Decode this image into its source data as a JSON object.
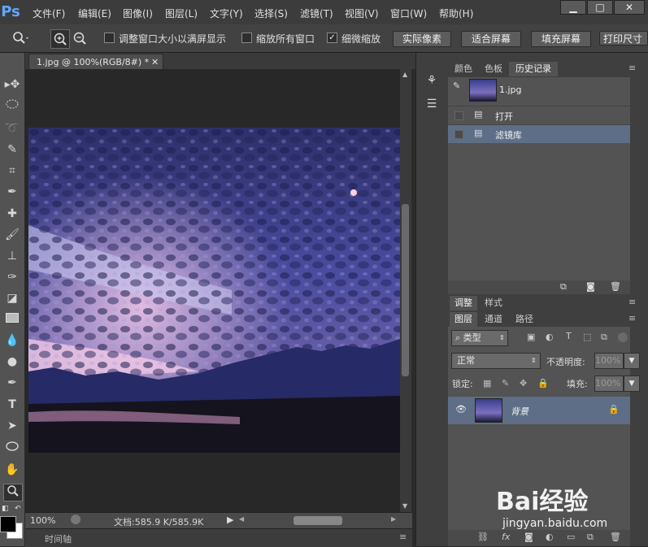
{
  "app": {
    "logo": "Ps"
  },
  "menu": [
    "文件(F)",
    "编辑(E)",
    "图像(I)",
    "图层(L)",
    "文字(Y)",
    "选择(S)",
    "滤镜(T)",
    "视图(V)",
    "窗口(W)",
    "帮助(H)"
  ],
  "window_controls": {
    "minimize": "▁",
    "maximize": "□",
    "close": "✕"
  },
  "options": {
    "resize_windows": {
      "label": "调整窗口大小以满屏显示",
      "checked": false
    },
    "zoom_all": {
      "label": "缩放所有窗口",
      "checked": false
    },
    "scrubby_zoom": {
      "label": "细微缩放",
      "checked": true
    },
    "actual_pixels": "实际像素",
    "fit_screen": "适合屏幕",
    "fill_screen": "填充屏幕",
    "print_size": "打印尺寸"
  },
  "document": {
    "tab_title": "1.jpg @ 100%(RGB/8#) *",
    "zoom": "100%",
    "doc_info": "文档:585.9 K/585.9K"
  },
  "timeline": {
    "label": "时间轴"
  },
  "panels": {
    "top_tabs": [
      "颜色",
      "色板",
      "历史记录"
    ],
    "history": {
      "snapshot": "1.jpg",
      "items": [
        "打开",
        "滤镜库"
      ]
    },
    "mid_tabs": [
      "调整",
      "样式"
    ],
    "layer_tabs": [
      "图层",
      "通道",
      "路径"
    ],
    "filter_kind": "类型",
    "blend_mode": "正常",
    "opacity_label": "不透明度:",
    "opacity_value": "100%",
    "lock_label": "锁定:",
    "fill_label": "填充:",
    "fill_value": "100%",
    "layer_name": "背景"
  },
  "watermark": {
    "brand": "Bai经验",
    "url": "jingyan.baidu.com"
  }
}
